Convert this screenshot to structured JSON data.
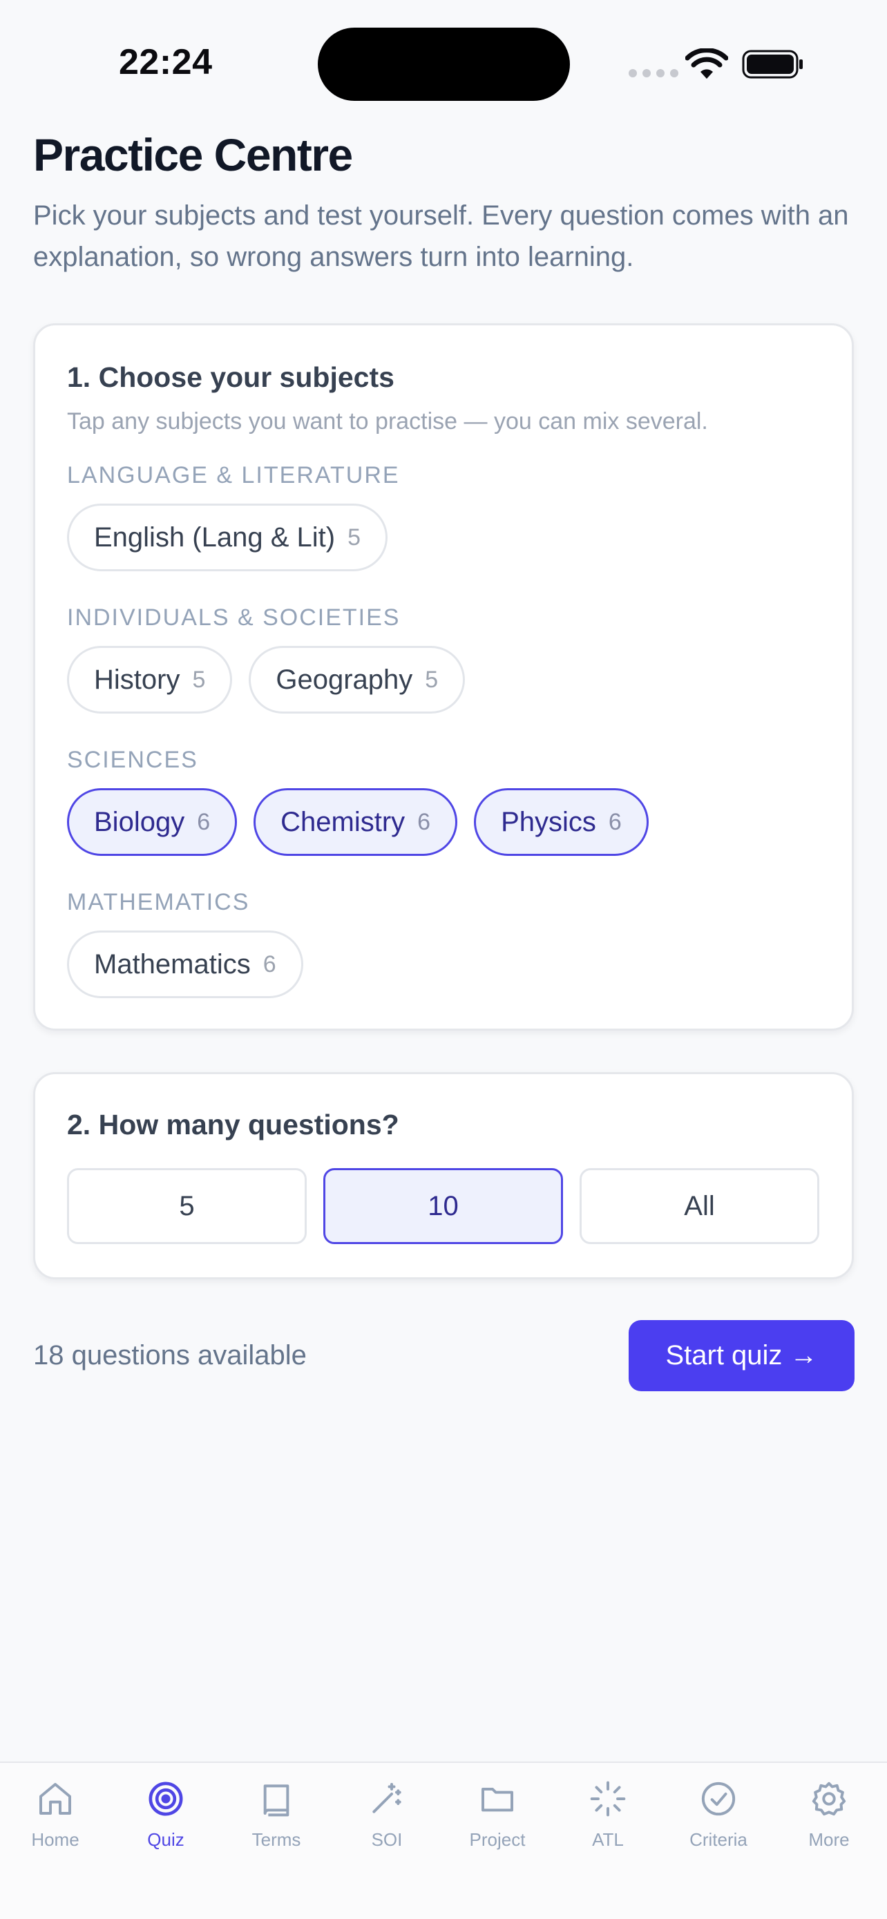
{
  "status_bar": {
    "time": "22:24"
  },
  "header": {
    "title": "Practice Centre",
    "subtitle": "Pick your subjects and test yourself. Every question comes with an explanation, so wrong answers turn into learning."
  },
  "subjects_card": {
    "heading": "1. Choose your subjects",
    "hint": "Tap any subjects you want to practise — you can mix several.",
    "groups": [
      {
        "label": "LANGUAGE & LITERATURE",
        "subjects": [
          {
            "name": "English (Lang & Lit)",
            "count": "5",
            "selected": false
          }
        ]
      },
      {
        "label": "INDIVIDUALS & SOCIETIES",
        "subjects": [
          {
            "name": "History",
            "count": "5",
            "selected": false
          },
          {
            "name": "Geography",
            "count": "5",
            "selected": false
          }
        ]
      },
      {
        "label": "SCIENCES",
        "subjects": [
          {
            "name": "Biology",
            "count": "6",
            "selected": true
          },
          {
            "name": "Chemistry",
            "count": "6",
            "selected": true
          },
          {
            "name": "Physics",
            "count": "6",
            "selected": true
          }
        ]
      },
      {
        "label": "MATHEMATICS",
        "subjects": [
          {
            "name": "Mathematics",
            "count": "6",
            "selected": false
          }
        ]
      }
    ]
  },
  "count_card": {
    "heading": "2. How many questions?",
    "options": [
      {
        "label": "5",
        "selected": false
      },
      {
        "label": "10",
        "selected": true
      },
      {
        "label": "All",
        "selected": false
      }
    ]
  },
  "footer": {
    "available_text": "18 questions available",
    "start_label": "Start quiz →"
  },
  "tab_bar": {
    "items": [
      {
        "label": "Home",
        "icon": "home-icon",
        "active": false
      },
      {
        "label": "Quiz",
        "icon": "target-icon",
        "active": true
      },
      {
        "label": "Terms",
        "icon": "book-icon",
        "active": false
      },
      {
        "label": "SOI",
        "icon": "wand-icon",
        "active": false
      },
      {
        "label": "Project",
        "icon": "folder-icon",
        "active": false
      },
      {
        "label": "ATL",
        "icon": "loader-icon",
        "active": false
      },
      {
        "label": "Criteria",
        "icon": "check-circle-icon",
        "active": false
      },
      {
        "label": "More",
        "icon": "gear-icon",
        "active": false
      }
    ],
    "active_color": "#4f46e5",
    "inactive_color": "#94a3b8"
  },
  "colors": {
    "accent": "#4b3ef0",
    "selected_bg": "#eef1fd"
  }
}
